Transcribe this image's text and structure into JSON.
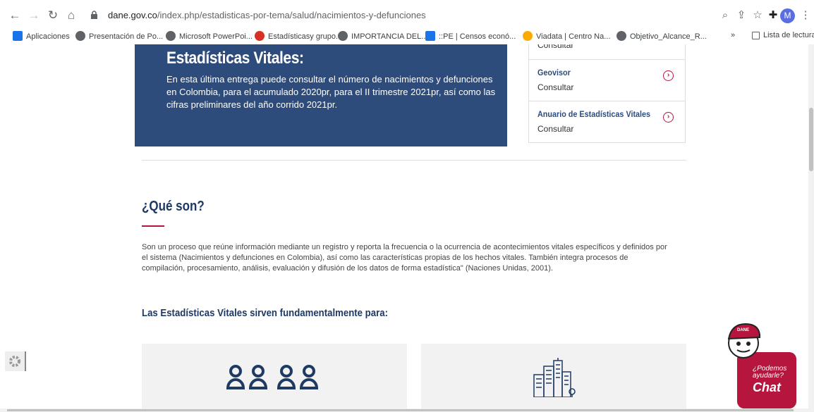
{
  "browser": {
    "url_domain": "dane.gov.co",
    "url_path": "/index.php/estadisticas-por-tema/salud/nacimientos-y-defunciones",
    "avatar_initial": "M",
    "bookmarks": [
      {
        "label": "Aplicaciones",
        "icon": "apps-icon",
        "color": "#1a73e8"
      },
      {
        "label": "Presentación de Po...",
        "icon": "globe-icon",
        "color": "#5f6368"
      },
      {
        "label": "Microsoft PowerPoi...",
        "icon": "globe-icon",
        "color": "#5f6368"
      },
      {
        "label": "Estadísticasy grupo...",
        "icon": "stats-icon",
        "color": "#d93025"
      },
      {
        "label": "IMPORTANCIA DEL...",
        "icon": "globe-icon",
        "color": "#5f6368"
      },
      {
        "label": "::PE | Censos econó...",
        "icon": "grid-icon",
        "color": "#1a73e8"
      },
      {
        "label": "Viadata | Centro Na...",
        "icon": "viadata-icon",
        "color": "#f9ab00"
      },
      {
        "label": "Objetivo_Alcance_R...",
        "icon": "globe-icon",
        "color": "#5f6368"
      }
    ],
    "more_label": "»",
    "reading_list_label": "Lista de lectura"
  },
  "hero": {
    "title": "Estadísticas Vitales:",
    "text": "En esta última entrega puede consultar el número de nacimientos y defunciones en Colombia, para el acumulado 2020pr, para el II trimestre 2021pr, así como las cifras preliminares del año corrido 2021pr."
  },
  "sidebox": {
    "items": [
      {
        "title": "",
        "sub": "Consultar"
      },
      {
        "title": "Geovisor",
        "sub": "Consultar"
      },
      {
        "title": "Anuario de Estadísticas Vitales",
        "sub": "Consultar"
      }
    ]
  },
  "section": {
    "title": "¿Qué son?",
    "body": "Son un proceso que reúne información mediante un registro y reporta la frecuencia o la ocurrencia de acontecimientos vitales específicos y definidos por el sistema (Nacimientos y defunciones en Colombia), así como las características propias de los hechos vitales. También integra procesos de compilación, procesamiento, análisis, evaluación y difusión de los datos de forma estadística\" (Naciones Unidas, 2001).",
    "subtitle": "Las Estadísticas Vitales sirven fundamentalmente para:"
  },
  "chat": {
    "badge": "DANE",
    "line1": "¿Podemos",
    "line2": "ayudarle?",
    "label": "Chat"
  },
  "colors": {
    "brand_blue": "#2d4c7c",
    "accent_red": "#b6163e"
  }
}
